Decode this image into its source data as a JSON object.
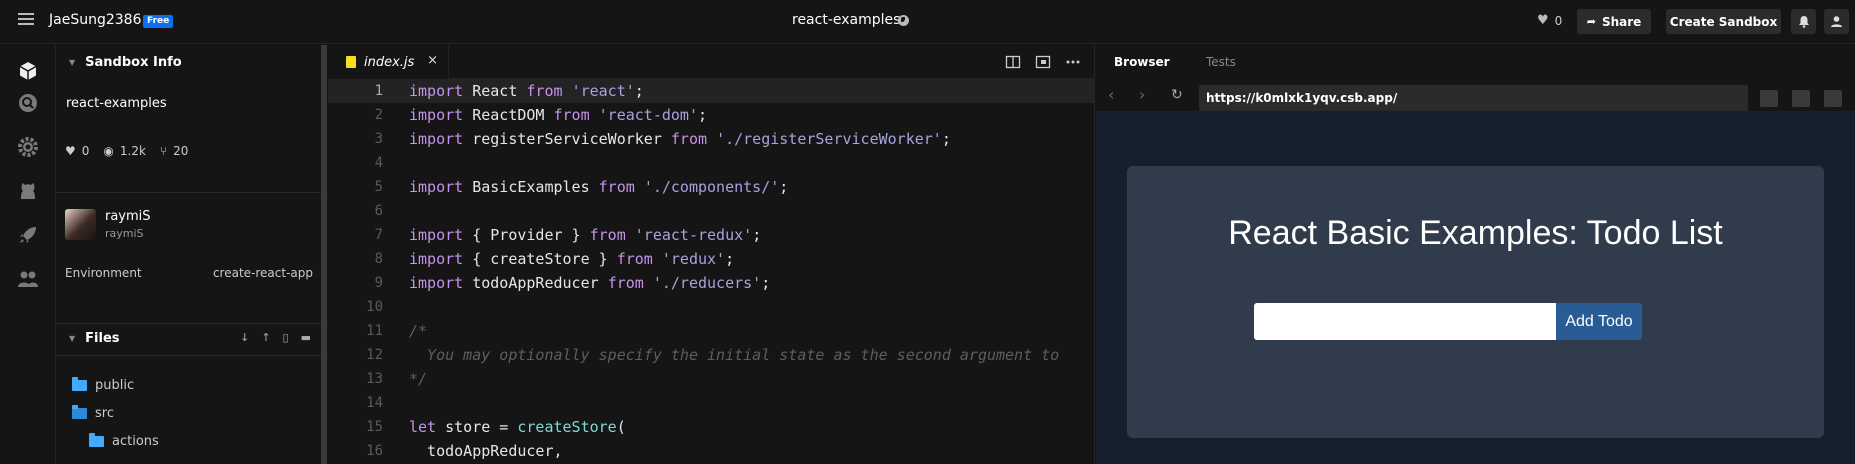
{
  "topbar": {
    "user": "JaeSung2386",
    "plan_badge": "Free",
    "sandbox_title": "react-examples",
    "likes": "0",
    "share_label": "Share",
    "create_label": "Create Sandbox"
  },
  "sidebar": {
    "info_title": "Sandbox Info",
    "sandbox_name": "react-examples",
    "stats": {
      "likes": "0",
      "views": "1.2k",
      "forks": "20"
    },
    "author": {
      "name": "raymiS",
      "handle": "raymiS"
    },
    "environment_label": "Environment",
    "environment_value": "create-react-app",
    "files_title": "Files",
    "files": [
      {
        "name": "public",
        "type": "folder"
      },
      {
        "name": "src",
        "type": "folder-open"
      },
      {
        "name": "actions",
        "type": "folder"
      }
    ]
  },
  "editor": {
    "active_tab": "index.js",
    "close_glyph": "×",
    "lines": [
      {
        "n": "1",
        "tokens": [
          [
            "kw",
            "import"
          ],
          [
            "id",
            " React "
          ],
          [
            "kw",
            "from"
          ],
          [
            "id",
            " "
          ],
          [
            "str",
            "'react'"
          ],
          [
            "id",
            ";"
          ]
        ]
      },
      {
        "n": "2",
        "tokens": [
          [
            "kw",
            "import"
          ],
          [
            "id",
            " ReactDOM "
          ],
          [
            "kw",
            "from"
          ],
          [
            "id",
            " "
          ],
          [
            "str",
            "'react-dom'"
          ],
          [
            "id",
            ";"
          ]
        ]
      },
      {
        "n": "3",
        "tokens": [
          [
            "kw",
            "import"
          ],
          [
            "id",
            " registerServiceWorker "
          ],
          [
            "kw",
            "from"
          ],
          [
            "id",
            " "
          ],
          [
            "str",
            "'./registerServiceWorker'"
          ],
          [
            "id",
            ";"
          ]
        ]
      },
      {
        "n": "4",
        "tokens": []
      },
      {
        "n": "5",
        "tokens": [
          [
            "kw",
            "import"
          ],
          [
            "id",
            " BasicExamples "
          ],
          [
            "kw",
            "from"
          ],
          [
            "id",
            " "
          ],
          [
            "str",
            "'./components/'"
          ],
          [
            "id",
            ";"
          ]
        ]
      },
      {
        "n": "6",
        "tokens": []
      },
      {
        "n": "7",
        "tokens": [
          [
            "kw",
            "import"
          ],
          [
            "id",
            " { Provider } "
          ],
          [
            "kw",
            "from"
          ],
          [
            "id",
            " "
          ],
          [
            "str",
            "'react-redux'"
          ],
          [
            "id",
            ";"
          ]
        ]
      },
      {
        "n": "8",
        "tokens": [
          [
            "kw",
            "import"
          ],
          [
            "id",
            " { createStore } "
          ],
          [
            "kw",
            "from"
          ],
          [
            "id",
            " "
          ],
          [
            "str",
            "'redux'"
          ],
          [
            "id",
            ";"
          ]
        ]
      },
      {
        "n": "9",
        "tokens": [
          [
            "kw",
            "import"
          ],
          [
            "id",
            " todoAppReducer "
          ],
          [
            "kw",
            "from"
          ],
          [
            "id",
            " "
          ],
          [
            "str",
            "'./reducers'"
          ],
          [
            "id",
            ";"
          ]
        ]
      },
      {
        "n": "10",
        "tokens": []
      },
      {
        "n": "11",
        "tokens": [
          [
            "cm",
            "/*"
          ]
        ]
      },
      {
        "n": "12",
        "tokens": [
          [
            "cm",
            "  You may optionally specify the initial state as the second argument to"
          ]
        ]
      },
      {
        "n": "13",
        "tokens": [
          [
            "cm",
            "*/"
          ]
        ]
      },
      {
        "n": "14",
        "tokens": []
      },
      {
        "n": "15",
        "tokens": [
          [
            "kw",
            "let"
          ],
          [
            "id",
            " store = "
          ],
          [
            "fn",
            "createStore"
          ],
          [
            "id",
            "("
          ]
        ]
      },
      {
        "n": "16",
        "tokens": [
          [
            "id",
            "  todoAppReducer,"
          ]
        ]
      }
    ]
  },
  "browser": {
    "tab_browser": "Browser",
    "tab_tests": "Tests",
    "url": "https://k0mlxk1yqv.csb.app/",
    "app_title": "React Basic Examples: Todo List",
    "add_button": "Add Todo"
  }
}
